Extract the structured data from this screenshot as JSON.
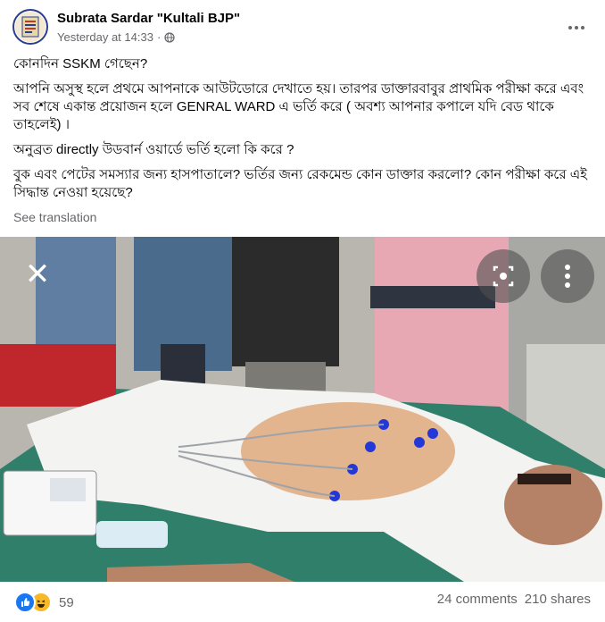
{
  "post": {
    "author": "Subrata Sardar \"Kultali BJP\"",
    "timestamp": "Yesterday at 14:33",
    "separator": "·",
    "paragraphs": [
      "কোনদিন SSKM গেছেন?",
      "আপনি অসুস্থ হলে প্রথমে আপনাকে আউটডোরে দেখাতে হয়। তারপর ডাক্তারবাবুর প্রাথমিক পরীক্ষা করে এবং সব শেষে একান্ত প্রয়োজন হলে GENRAL WARD এ ভর্তি করে ( অবশ্য আপনার কপালে যদি বেড থাকে তাহলেই) ।",
      "অনুব্রত directly উডবার্ন ওয়ার্ডে ভর্তি হলো কি করে ?",
      "বুক এবং পেটের সমস্যার জন্য হাসপাতালে? ভর্তির জন্য রেকমেন্ড কোন ডাক্তার করলো? কোন পরীক্ষা করে এই সিদ্ধান্ত নেওয়া হয়েছে?"
    ],
    "see_translation": "See translation"
  },
  "overlay": {
    "close_glyph": "✕"
  },
  "icons": {
    "more": "more-options-icon",
    "privacy": "globe-icon",
    "close": "close-icon",
    "lens": "lens-icon",
    "overflow": "vertical-more-icon",
    "like": "like-reaction-icon",
    "haha": "haha-reaction-icon"
  },
  "footer": {
    "reaction_count": "59",
    "comments": "24 comments",
    "shares": "210 shares"
  },
  "colors": {
    "like_blue": "#1877f2",
    "haha_yellow": "#f7b928",
    "secondary_text": "#65676b"
  }
}
